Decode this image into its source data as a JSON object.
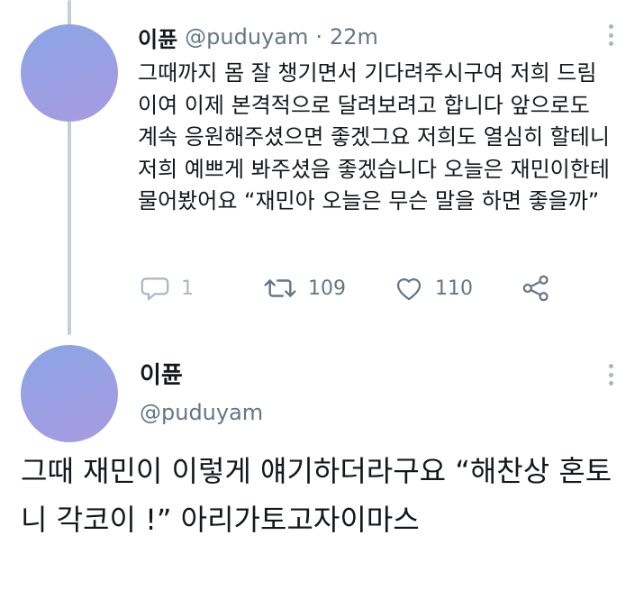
{
  "tweet1": {
    "name": "이퓬",
    "handle": "@puduyam",
    "separator": "·",
    "time": "22m",
    "text": "그때까지 몸 잘 챙기면서 기다려주시구여 저희 드림이여 이제 본격적으로 달려보려고 합니다 앞으로도 계속 응원해주셨으면 좋겠그요 저희도 열심히 할테니 저희 예쁘게 봐주셨음 좋겠습니다 오늘은 재민이한테 물어봤어요 “재민아 오늘은 무슨 말을 하면 좋을까”",
    "actions": {
      "reply_count": "1",
      "retweet_count": "109",
      "like_count": "110"
    },
    "icons": {
      "more": "more-vertical-icon",
      "reply": "reply-icon",
      "retweet": "retweet-icon",
      "like": "heart-icon",
      "share": "share-icon"
    }
  },
  "tweet2": {
    "name": "이퓬",
    "handle": "@puduyam",
    "text": "그때 재민이 이렇게 얘기하더라구요 “해찬상 혼토니 각코이 !” 아리가토고자이마스"
  },
  "colors": {
    "text": "#14171a",
    "secondary": "#657786",
    "thread_line": "#c4cfd6",
    "avatar_start": "#8aa6e6",
    "avatar_end": "#a99ae0"
  }
}
